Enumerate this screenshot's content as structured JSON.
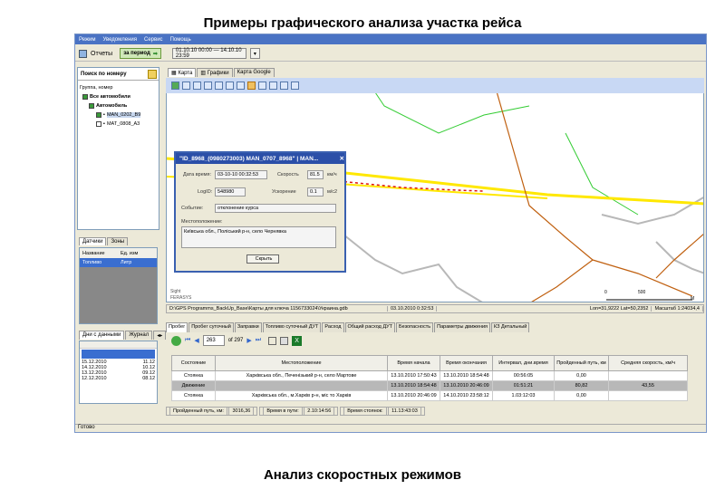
{
  "slide": {
    "title": "Примеры графического анализа участка рейса",
    "caption": "Анализ скоростных режимов"
  },
  "menu": [
    "Режим",
    "Уведомления",
    "Сервис",
    "Помощь"
  ],
  "toolbar": {
    "reports_label": "Отчеты",
    "period_label": "за период",
    "date_range": "01.10.10 00:00 — 14.10.10 23:59"
  },
  "left": {
    "search_label": "Поиск по номеру",
    "tree_header": "Группа, номер",
    "tree_items": [
      "Все автомобили",
      "Автомобиль",
      "MAN_0202_B9",
      "MAT_0808_A3"
    ],
    "sensor_tabs": [
      "Датчики",
      "Зоны"
    ],
    "sensor_cols": [
      "Название",
      "Ед. изм"
    ],
    "sensor_row": [
      "Топливо",
      "Литр"
    ],
    "days_tabs": [
      "Дни с данными",
      "Журнал"
    ],
    "days": [
      {
        "date": "15.12.2010",
        "val": "11.12"
      },
      {
        "date": "14.12.2010",
        "val": "10.12"
      },
      {
        "date": "13.12.2010",
        "val": "09.12"
      },
      {
        "date": "12.12.2010",
        "val": "08.12"
      }
    ]
  },
  "map": {
    "tabs": [
      "Карта",
      "Графики",
      "Карта Google"
    ],
    "scale_labels": [
      "0",
      "500",
      "M"
    ],
    "corner_text": [
      "Sight",
      "FERASYS"
    ],
    "status": [
      "D:\\GPS Programms_BackUp_Base\\Карты для ключа 1156733024\\Украина.gdb",
      "03.10.2010 0:32:53",
      "Lon=31,9222 Lat=50,2352",
      "Масштаб 1:24034,4"
    ]
  },
  "popup": {
    "title": "\"ID_8968_(0980273003) MAN_0707_8968\" | MAN...",
    "date_label": "Дата время:",
    "date_value": "03-10-10 00:32:53",
    "speed_label": "Скорость",
    "speed_value": "81.5",
    "speed_unit": "км/ч",
    "logid_label": "LogID:",
    "logid_value": "548980",
    "accel_label": "Ускорение",
    "accel_value": "0.1",
    "accel_unit": "м/с2",
    "event_label": "Событие:",
    "event_value": "отклонение курса",
    "location_label": "Местоположение:",
    "location_value": "Київська обл., Поліський р-н, село Чернявка",
    "hide_button": "Скрыть"
  },
  "bottom": {
    "tabs": [
      "Пробег",
      "Пробег суточный",
      "Заправки",
      "Топливо суточный ДУТ",
      "Расход",
      "Общий расход ДУТ",
      "Безопасность",
      "Параметры движения",
      "КЗ Детальный"
    ],
    "page_current": "263",
    "page_total": "of 297"
  },
  "table": {
    "headers": [
      "Состояние",
      "Местоположение",
      "Время начала",
      "Время окончания",
      "Интервал, дни.время",
      "Пройденный путь, км",
      "Средняя скорость, км/ч"
    ],
    "rows": [
      [
        "Стоянка",
        "Харківська обл., Печенізький р-н, село Мартове",
        "13.10.2010 17:50:43",
        "13.10.2010 18:54:48",
        "00:56:05",
        "0,00",
        ""
      ],
      [
        "Движение",
        "",
        "13.10.2010 18:54:48",
        "13.10.2010 20:46:09",
        "01:51:21",
        "80,82",
        "43,55"
      ],
      [
        "Стоянка",
        "Харківська обл., м.Харків р-н, міс то Харків",
        "13.10.2010 20:46:09",
        "14.10.2010 23:58:12",
        "1.03:12:03",
        "0,00",
        ""
      ]
    ]
  },
  "summary": {
    "distance_label": "Пройденный путь, км:",
    "distance_value": "3016,36",
    "moving_label": "Время в пути:",
    "moving_value": "2.10:14:56",
    "stop_label": "Время стоянок:",
    "stop_value": "11.13:43:03"
  },
  "app_status": "Готово"
}
